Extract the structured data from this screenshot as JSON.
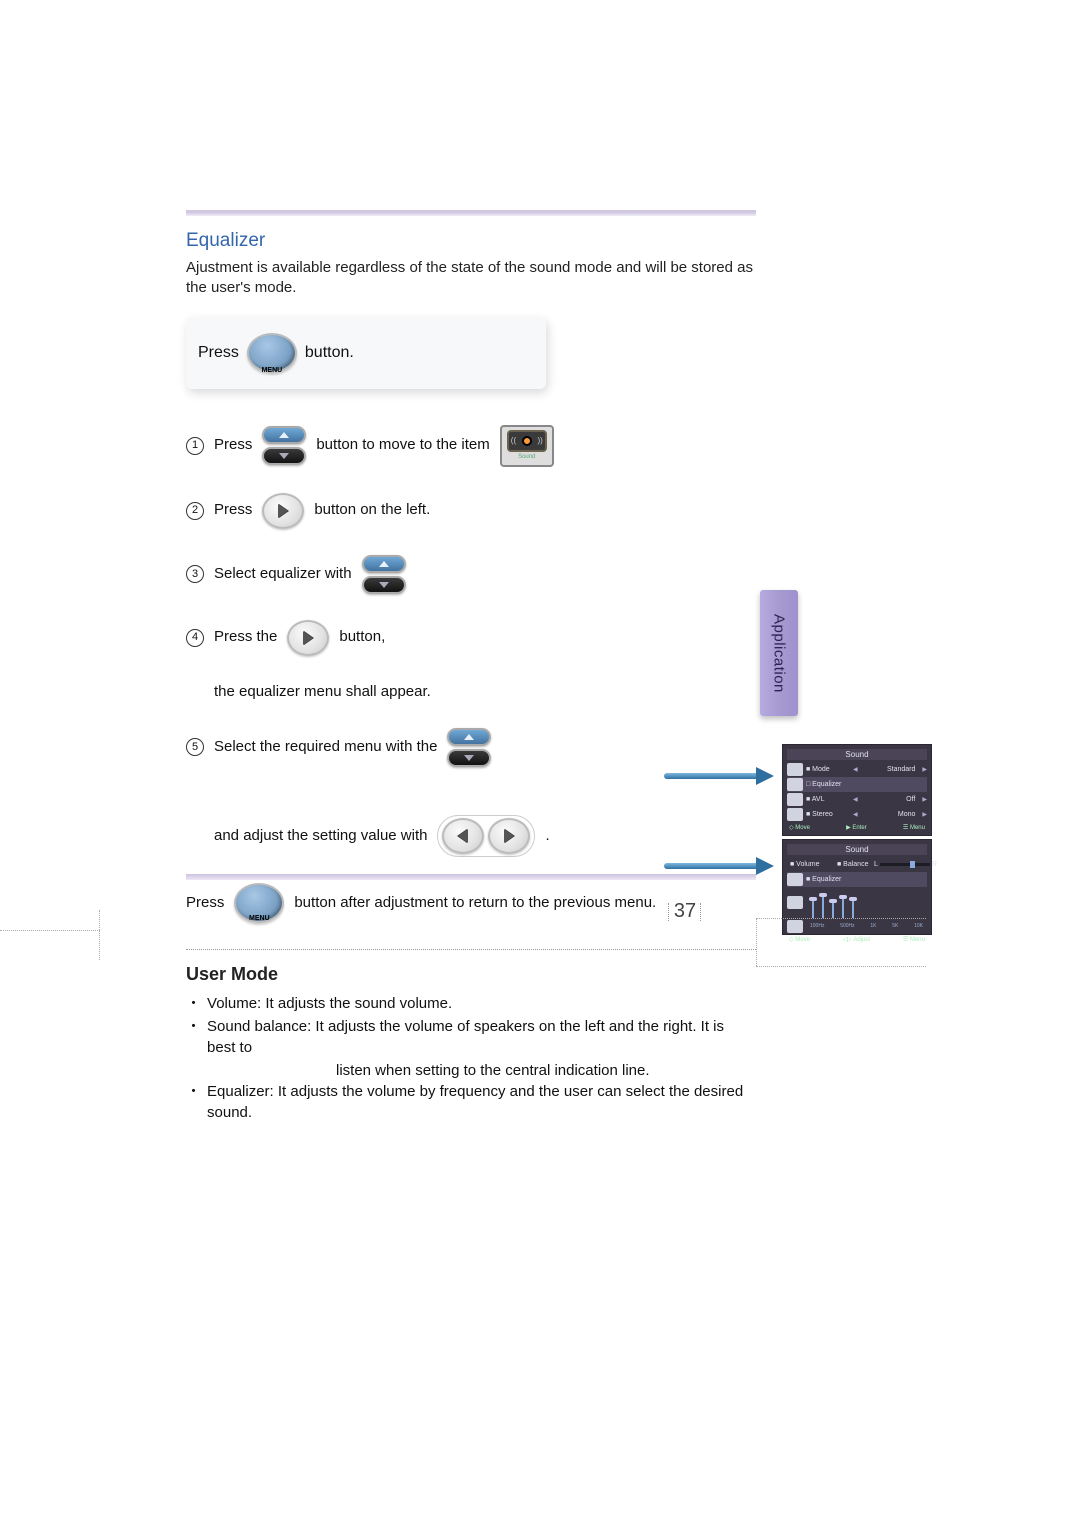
{
  "section": {
    "title": "Equalizer",
    "intro": "Ajustment is available regardless of the state of the sound mode and will be stored as the user's mode."
  },
  "top_step": {
    "press": "Press",
    "button": "button."
  },
  "steps": {
    "s1": {
      "num": "1",
      "press": "Press",
      "text_after": "button to move to the item"
    },
    "s2": {
      "num": "2",
      "press": "Press",
      "text_after": "button on the left."
    },
    "s3": {
      "num": "3",
      "text": "Select equalizer with"
    },
    "s4": {
      "num": "4",
      "press": "Press the",
      "button_word": "button,",
      "line2": "the equalizer menu shall appear."
    },
    "s5": {
      "num": "5",
      "text": "Select the required menu with the",
      "line2": "and adjust the setting value with",
      "period": "."
    },
    "final": {
      "press": "Press",
      "text_after": "button after adjustment to return to the previous menu."
    }
  },
  "icons": {
    "menu_label": "MENU",
    "sound_label": "Sound"
  },
  "osd1": {
    "title": "Sound",
    "rows": [
      {
        "label": "■ Mode",
        "value": "Standard"
      },
      {
        "label": "□ Equalizer",
        "value": ""
      },
      {
        "label": "■ AVL",
        "value": "Off"
      },
      {
        "label": "■ Stereo",
        "value": "Mono"
      }
    ],
    "footer": {
      "move": "◇ Move",
      "enter": "▶ Enter",
      "menu": "☰ Menu"
    }
  },
  "osd2": {
    "title": "Sound",
    "volume": "■ Volume",
    "balance": "■ Balance",
    "equalizer": "■ Equalizer",
    "freqs": [
      "100Hz",
      "500Hz",
      "1K",
      "5K",
      "10K"
    ],
    "footer": {
      "move": "◇ Move",
      "adjust": "◁▷ Adjust",
      "menu": "☰ Menu"
    }
  },
  "side_tab": "Application",
  "user_mode": {
    "title": "User Mode",
    "bullets": [
      "Volume: It adjusts the sound volume.",
      "Sound balance: It adjusts the volume of speakers on the left and the right. It is best to",
      "Equalizer: It adjusts the volume by frequency and the user can select the desired sound."
    ],
    "b2_indent": "listen when setting to the central indication line."
  },
  "page_number": "37"
}
